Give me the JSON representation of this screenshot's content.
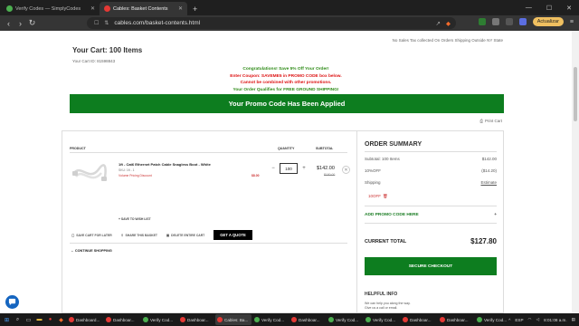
{
  "browser": {
    "tabs": [
      {
        "title": "Verify Codes — SimplyCodes",
        "active": false,
        "favicon_color": "#4caf50"
      },
      {
        "title": "Cables: Basket Contents",
        "active": true,
        "favicon_color": "#e53935"
      }
    ],
    "url": "cables.com/basket-contents.html",
    "update_label": "Actualizar"
  },
  "page": {
    "cart_title": "Your Cart: 100 Items",
    "cart_id": "Your Cart ID: 81598843",
    "tax_note": "No Sales Tax collected On Orders Shipping Outside NY State",
    "promo": {
      "line1": "Congratulations! Save 5% Off Your Order!",
      "line2": "Enter Coupon: SAVEME5 in PROMO CODE box below.",
      "line3": "Cannot be combined with other promotions.",
      "line4": "Your Order Qualifies for FREE GROUND SHIPPING!"
    },
    "banner": "Your Promo Code Has Been Applied",
    "print_cart": "Print Cart",
    "table": {
      "col_product": "PRODUCT",
      "col_quantity": "QUANTITY",
      "col_subtotal": "SUBTOTAL"
    },
    "item": {
      "name": "1ft - Cat6 Ethernet Patch Cable Snagless Boot - White",
      "sku": "SKU: 1ft - 1",
      "volume": "Volume Pricing Discount",
      "savings": "$8.00",
      "quantity": "100",
      "price": "$142.00",
      "old_price": "$150.00",
      "save_wish": "+ SAVE TO WISH LIST"
    },
    "actions": {
      "save_cart": "SAVE CART FOR LATER",
      "share": "SHARE THIS BASKET",
      "delete": "DELETE ENTIRE CART",
      "quote": "GET A QUOTE"
    },
    "continue": "CONTINUE SHOPPING",
    "summary": {
      "title": "ORDER SUMMARY",
      "subtotal_label": "Subtotal: 100 Items",
      "subtotal_value": "$142.00",
      "discount_label": "10%OFF",
      "discount_value": "($14.20)",
      "shipping_label": "Shipping",
      "shipping_value": "Estimate",
      "code_chip": "10OFF",
      "add_promo": "ADD PROMO CODE HERE",
      "add_promo_icon": "+",
      "total_label": "CURRENT TOTAL",
      "total_value": "$127.80",
      "checkout": "SECURE CHECKOUT",
      "help_title": "HELPFUL INFO",
      "help_line1": "We can help you along the way.",
      "help_line2": "Give us a call or email."
    }
  },
  "taskbar": {
    "items": [
      {
        "label": "Dashboard...",
        "color": "#e53935"
      },
      {
        "label": "Dashboar...",
        "color": "#e53935"
      },
      {
        "label": "Verify Cod...",
        "color": "#4caf50"
      },
      {
        "label": "Dashboar...",
        "color": "#e53935"
      },
      {
        "label": "Cables: Ba...",
        "color": "#e53935"
      },
      {
        "label": "Verify Cod...",
        "color": "#4caf50"
      },
      {
        "label": "Dashboar...",
        "color": "#e53935"
      },
      {
        "label": "Verify Cod...",
        "color": "#4caf50"
      },
      {
        "label": "Verify Cod...",
        "color": "#4caf50"
      },
      {
        "label": "Dashboar...",
        "color": "#e53935"
      },
      {
        "label": "Dashboar...",
        "color": "#e53935"
      },
      {
        "label": "Verify Cod...",
        "color": "#4caf50"
      }
    ],
    "lang": "ESP",
    "time": "8:01:08 a.m."
  }
}
